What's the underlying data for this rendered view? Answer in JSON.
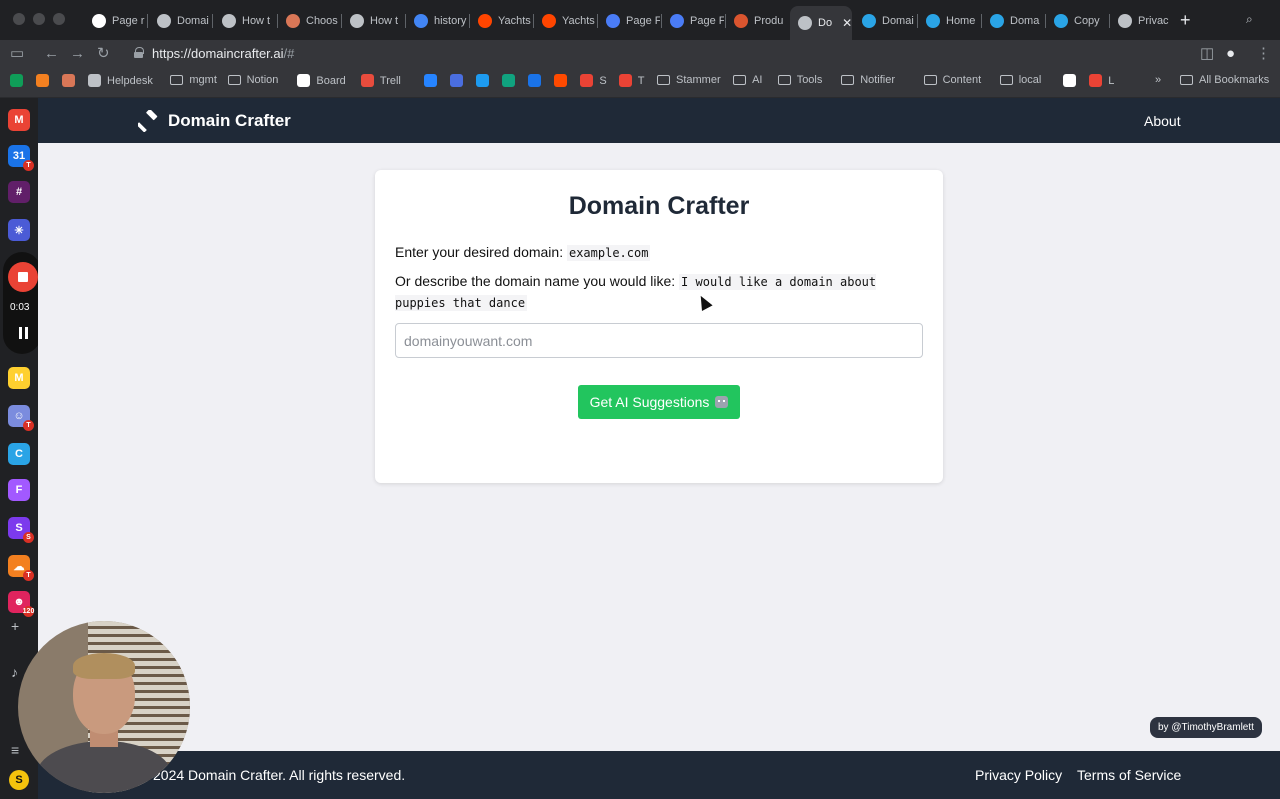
{
  "browser": {
    "tabs": [
      {
        "label": "Page r",
        "favicon": "github-icon",
        "color": "#ffffff"
      },
      {
        "label": "Domai",
        "favicon": "globe-icon",
        "color": "#bdc1c6"
      },
      {
        "label": "How t",
        "favicon": "globe-icon",
        "color": "#bdc1c6"
      },
      {
        "label": "Choos",
        "favicon": "claude-icon",
        "color": "#d97757"
      },
      {
        "label": "How t",
        "favicon": "globe-icon",
        "color": "#bdc1c6"
      },
      {
        "label": "history",
        "favicon": "google-icon",
        "color": "#4285f4"
      },
      {
        "label": "Yachts",
        "favicon": "reddit-icon",
        "color": "#ff4500"
      },
      {
        "label": "Yachts",
        "favicon": "reddit-icon",
        "color": "#ff4500"
      },
      {
        "label": "Page F",
        "favicon": "t-icon",
        "color": "#4a7cf6"
      },
      {
        "label": "Page F",
        "favicon": "t-icon",
        "color": "#4a7cf6"
      },
      {
        "label": "Produ",
        "favicon": "producthunt-icon",
        "color": "#da552f"
      },
      {
        "label": "Do",
        "favicon": "globe-icon",
        "color": "#bdc1c6"
      },
      {
        "label": "Domai",
        "favicon": "c-icon",
        "color": "#2aa4e6"
      },
      {
        "label": "Home",
        "favicon": "c-icon",
        "color": "#2aa4e6"
      },
      {
        "label": "Doma",
        "favicon": "c-icon",
        "color": "#2aa4e6"
      },
      {
        "label": "Copy",
        "favicon": "c-icon",
        "color": "#2aa4e6"
      },
      {
        "label": "Privac",
        "favicon": "layers-icon",
        "color": "#bdc1c6"
      }
    ],
    "close_glyph": "✕",
    "new_tab_glyph": "+",
    "url_host": "https://domaincrafter.ai",
    "url_rest": "/#",
    "bookmarks": [
      {
        "label": "",
        "icon": "sheets-icon",
        "color": "#0f9d58"
      },
      {
        "label": "",
        "icon": "cloudflare-icon",
        "color": "#f38020"
      },
      {
        "label": "",
        "icon": "claude-icon",
        "color": "#d97757"
      },
      {
        "label": "Helpdesk",
        "icon": "helpdesk-icon",
        "color": "#bdc1c6"
      },
      {
        "label": "mgmt",
        "icon": "folder-icon",
        "color": "#bdc1c6"
      },
      {
        "label": "Notion",
        "icon": "folder-icon",
        "color": "#bdc1c6"
      },
      {
        "label": "Board",
        "icon": "github-icon",
        "color": "#ffffff"
      },
      {
        "label": "Trell",
        "icon": "trello-icon",
        "color": "#e84c3d"
      },
      {
        "label": "",
        "icon": "sync-icon",
        "color": "#2684ff"
      },
      {
        "label": "",
        "icon": "l-icon",
        "color": "#4a6ee0"
      },
      {
        "label": "",
        "icon": "bird-icon",
        "color": "#1d9bf0"
      },
      {
        "label": "",
        "icon": "openai-icon",
        "color": "#10a37f"
      },
      {
        "label": "",
        "icon": "calendar-icon",
        "color": "#1a73e8"
      },
      {
        "label": "",
        "icon": "zap-icon",
        "color": "#ff4a00"
      },
      {
        "label": "S",
        "icon": "gmail-icon",
        "color": "#ea4335"
      },
      {
        "label": "T",
        "icon": "gmail-icon",
        "color": "#ea4335"
      },
      {
        "label": "Stammer",
        "icon": "folder-icon",
        "color": "#bdc1c6"
      },
      {
        "label": "AI",
        "icon": "folder-icon",
        "color": "#bdc1c6"
      },
      {
        "label": "Tools",
        "icon": "folder-icon",
        "color": "#bdc1c6"
      },
      {
        "label": "Notifier",
        "icon": "folder-icon",
        "color": "#bdc1c6"
      },
      {
        "label": "Content",
        "icon": "folder-icon",
        "color": "#bdc1c6"
      },
      {
        "label": "local",
        "icon": "folder-icon",
        "color": "#bdc1c6"
      },
      {
        "label": "",
        "icon": "c-icon",
        "color": "#ffffff"
      },
      {
        "label": "L",
        "icon": "gmail-icon",
        "color": "#ea4335"
      }
    ],
    "more_glyph": "»",
    "all_bookmarks": "All Bookmarks"
  },
  "dock": {
    "recording_time": "0:03",
    "apps": [
      {
        "name": "gmail-app",
        "letter": "M",
        "color": "#ea4335",
        "badge": ""
      },
      {
        "name": "calendar-app",
        "letter": "31",
        "color": "#1a73e8",
        "badge": "T"
      },
      {
        "name": "slack-app",
        "letter": "#",
        "color": "#611f69",
        "badge": ""
      },
      {
        "name": "perplexity-app",
        "letter": "✳",
        "color": "#4b5bd6",
        "badge": ""
      },
      {
        "name": "miro-app",
        "letter": "M",
        "color": "#ffd02f",
        "badge": ""
      },
      {
        "name": "discord-app",
        "letter": "☺",
        "color": "#7b8cde",
        "badge": "T"
      },
      {
        "name": "c-app",
        "letter": "C",
        "color": "#2aa4e6",
        "badge": ""
      },
      {
        "name": "figma-app",
        "letter": "F",
        "color": "#a259ff",
        "badge": ""
      },
      {
        "name": "s-app",
        "letter": "S",
        "color": "#7c3aed",
        "badge": "S"
      },
      {
        "name": "cloud-app",
        "letter": "☁",
        "color": "#f38020",
        "badge": "T"
      },
      {
        "name": "chat-app",
        "letter": "☻",
        "color": "#e0245e",
        "badge": "120"
      }
    ],
    "user_initial": "S"
  },
  "site": {
    "brand": "Domain Crafter",
    "nav_about": "About",
    "card_title": "Domain Crafter",
    "line1_prefix": "Enter your desired domain:",
    "line1_code": "example.com",
    "line2_prefix": "Or describe the domain name you would like:",
    "line2_code": "I would like a domain about puppies that dance",
    "input_placeholder": "domainyouwant.com",
    "button_label": "Get AI Suggestions",
    "attribution": "by @TimothyBramlett",
    "copyright": "2024 Domain Crafter. All rights reserved.",
    "privacy": "Privacy Policy",
    "terms": "Terms of Service"
  },
  "colors": {
    "accent_green": "#22c55e",
    "nav_bg": "#1f2937",
    "page_bg": "#f0f0f4"
  }
}
